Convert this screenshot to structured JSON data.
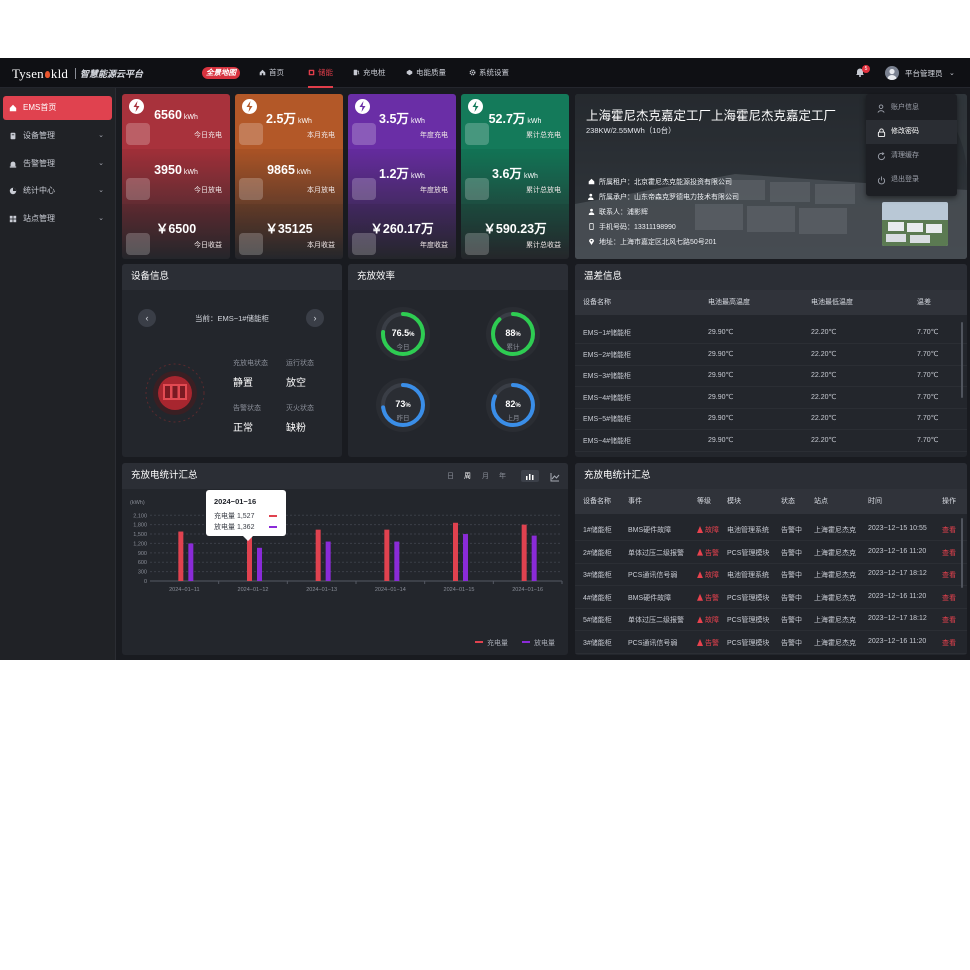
{
  "header": {
    "logo": "Tysen",
    "logo_tail": "kld",
    "platform": "智慧能源云平台",
    "map_badge": "全景地图",
    "nav": [
      "首页",
      "储能",
      "充电桩",
      "电能质量",
      "系统设置"
    ],
    "active_nav": "储能",
    "notification_count": "5",
    "username": "平台管理员"
  },
  "sidebar": {
    "items": [
      {
        "label": "EMS首页",
        "active": true,
        "icon": "home-icon"
      },
      {
        "label": "设备管理",
        "icon": "device-icon"
      },
      {
        "label": "告警管理",
        "icon": "alarm-icon"
      },
      {
        "label": "统计中心",
        "icon": "chart-icon"
      },
      {
        "label": "站点管理",
        "icon": "grid-icon"
      }
    ]
  },
  "user_menu": {
    "items": [
      "账户信息",
      "修改密码",
      "清理缓存",
      "退出登录"
    ],
    "highlighted": "修改密码"
  },
  "stats": [
    {
      "icon": "lightning-icon",
      "color": "#a8323c",
      "rows": [
        {
          "value": "6560",
          "unit": "kWh",
          "label": "今日充电"
        },
        {
          "value": "3950",
          "unit": "kWh",
          "label": "今日放电"
        },
        {
          "value": "￥6500",
          "unit": "",
          "label": "今日收益"
        }
      ]
    },
    {
      "icon": "lightning-icon",
      "color": "#b35828",
      "rows": [
        {
          "value": "2.5万",
          "unit": "kWh",
          "label": "本月充电"
        },
        {
          "value": "9865",
          "unit": "kWh",
          "label": "本月放电"
        },
        {
          "value": "￥35125",
          "unit": "",
          "label": "本月收益"
        }
      ]
    },
    {
      "icon": "lightning-icon",
      "color": "#6a2ea6",
      "rows": [
        {
          "value": "3.5万",
          "unit": "kWh",
          "label": "年度充电"
        },
        {
          "value": "1.2万",
          "unit": "kWh",
          "label": "年度放电"
        },
        {
          "value": "￥260.17万",
          "unit": "",
          "label": "年度收益"
        }
      ]
    },
    {
      "icon": "lightning-icon",
      "color": "#147a5a",
      "rows": [
        {
          "value": "52.7万",
          "unit": "kWh",
          "label": "累计总充电"
        },
        {
          "value": "3.6万",
          "unit": "kWh",
          "label": "累计总放电"
        },
        {
          "value": "￥590.23万",
          "unit": "",
          "label": "累计总收益"
        }
      ]
    }
  ],
  "site": {
    "title": "上海霍尼杰克嘉定工厂上海霍尼杰克嘉定工厂",
    "capacity": "238KW/2.55MWh（10台）",
    "info": [
      {
        "icon": "home-icon",
        "text": "所属租户：北京霍尼杰克能源投资有限公司"
      },
      {
        "icon": "users-icon",
        "text": "所属承户：山东帝森克罗德电力技术有限公司"
      },
      {
        "icon": "user-icon",
        "text": "联系人：浦影辉"
      },
      {
        "icon": "phone-icon",
        "text": "手机号码：13311198990"
      },
      {
        "icon": "location-icon",
        "text": "地址：上海市嘉定区北风七路50号201"
      }
    ]
  },
  "device": {
    "title": "设备信息",
    "current": "当前：EMS−1#储能柜",
    "labels": [
      "充放电状态",
      "运行状态",
      "告警状态",
      "灭火状态"
    ],
    "values": [
      "静置",
      "放空",
      "正常",
      "缺粉"
    ]
  },
  "efficiency": {
    "title": "充放效率",
    "gauges": [
      {
        "value": "76.5",
        "unit": "%",
        "label": "今日",
        "fraction": 0.765,
        "color": "#2ecc52"
      },
      {
        "value": "88",
        "unit": "%",
        "label": "累计",
        "fraction": 0.88,
        "color": "#2ecc52"
      },
      {
        "value": "73",
        "unit": "%",
        "label": "昨日",
        "fraction": 0.73,
        "color": "#3a8ee8"
      },
      {
        "value": "82",
        "unit": "%",
        "label": "上月",
        "fraction": 0.82,
        "color": "#3a8ee8"
      }
    ]
  },
  "temperature": {
    "title": "温差信息",
    "headers": [
      "设备名称",
      "电池最高温度",
      "电池最低温度",
      "温差"
    ],
    "rows": [
      [
        "EMS−1#储能柜",
        "29.90℃",
        "22.20℃",
        "7.70℃"
      ],
      [
        "EMS−2#储能柜",
        "29.90℃",
        "22.20℃",
        "7.70℃"
      ],
      [
        "EMS−3#储能柜",
        "29.90℃",
        "22.20℃",
        "7.70℃"
      ],
      [
        "EMS−4#储能柜",
        "29.90℃",
        "22.20℃",
        "7.70℃"
      ],
      [
        "EMS−5#储能柜",
        "29.90℃",
        "22.20℃",
        "7.70℃"
      ],
      [
        "EMS−4#储能柜",
        "29.90℃",
        "22.20℃",
        "7.70℃"
      ]
    ]
  },
  "chart_panel": {
    "title": "充放电统计汇总",
    "ranges": [
      "日",
      "周",
      "月",
      "年"
    ],
    "active_range": "周"
  },
  "chart_data": {
    "type": "bar",
    "ylabel": "(kWh)",
    "categories": [
      "2024−01−11",
      "2024−01−12",
      "2024−01−13",
      "2024−01−14",
      "2024−01−15",
      "2024−01−16"
    ],
    "series": [
      {
        "name": "充电量",
        "color": "#e0424f",
        "values": [
          1580,
          1460,
          1640,
          1640,
          1860,
          1800
        ]
      },
      {
        "name": "放电量",
        "color": "#8a2bd8",
        "values": [
          1200,
          1060,
          1260,
          1260,
          1500,
          1450
        ]
      }
    ],
    "yticks": [
      0,
      300,
      600,
      900,
      1200,
      1500,
      1800,
      2100
    ],
    "ytick_labels": [
      "0",
      "300",
      "600",
      "900",
      "1,200",
      "1,500",
      "1,800",
      "2,100"
    ],
    "ylim": [
      0,
      2300
    ],
    "tooltip": {
      "date": "2024−01−16",
      "rows": [
        "充电量 1,527",
        "放电量 1,362"
      ]
    }
  },
  "events": {
    "title": "充放电统计汇总",
    "headers": [
      "设备名称",
      "事件",
      "等级",
      "模块",
      "状态",
      "站点",
      "时间",
      "操作"
    ],
    "rows": [
      [
        "1#储能柜",
        "BMS硬件故障",
        "故障",
        "电池管理系统",
        "告警中",
        "上海霍尼杰克",
        "2023−12−15 10:55",
        "查看"
      ],
      [
        "2#储能柜",
        "单体过压二级报警",
        "告警",
        "PCS管理模块",
        "告警中",
        "上海霍尼杰克",
        "2023−12−16 11:20",
        "查看"
      ],
      [
        "3#储能柜",
        "PCS通讯信号弱",
        "故障",
        "电池管理系统",
        "告警中",
        "上海霍尼杰克",
        "2023−12−17 18:12",
        "查看"
      ],
      [
        "4#储能柜",
        "BMS硬件故障",
        "告警",
        "PCS管理模块",
        "告警中",
        "上海霍尼杰克",
        "2023−12−16 11:20",
        "查看"
      ],
      [
        "5#储能柜",
        "单体过压二级报警",
        "故障",
        "PCS管理模块",
        "告警中",
        "上海霍尼杰克",
        "2023−12−17 18:12",
        "查看"
      ],
      [
        "3#储能柜",
        "PCS通讯信号弱",
        "告警",
        "PCS管理模块",
        "告警中",
        "上海霍尼杰克",
        "2023−12−16 11:20",
        "查看"
      ]
    ]
  }
}
